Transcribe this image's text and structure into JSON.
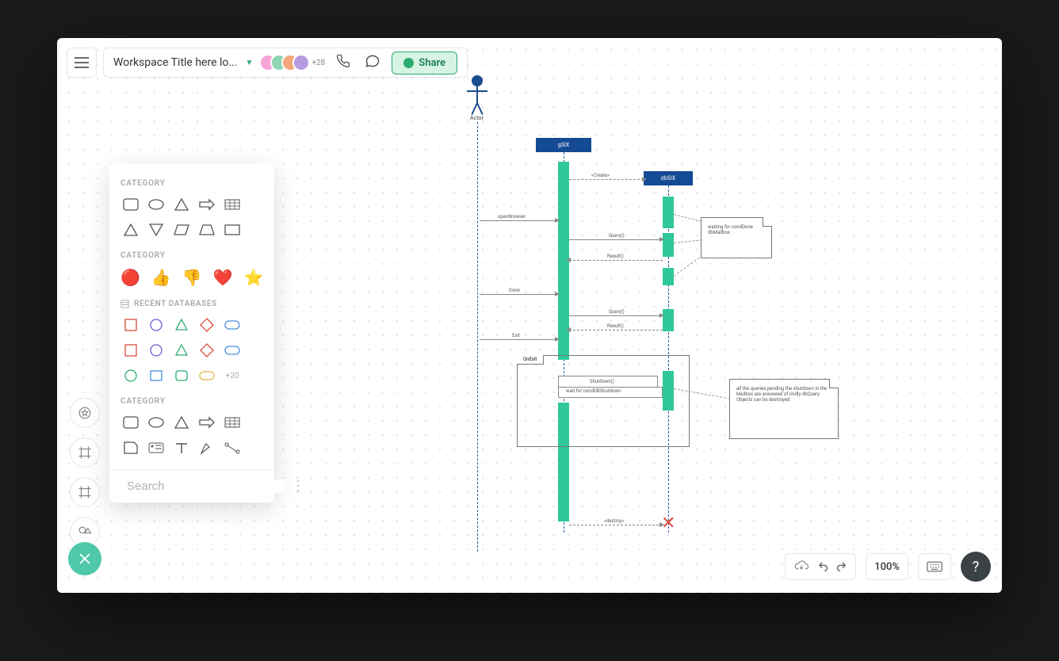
{
  "topbar": {
    "workspace_title": "Workspace Title here lo...",
    "avatar_overflow": "+28",
    "share_label": "Share"
  },
  "panel": {
    "cat1": "CATEGORY",
    "cat2": "CATEGORY",
    "db_label": "RECENT DATABASES",
    "more": "+20",
    "cat3": "CATEGORY",
    "search_placeholder": "Search"
  },
  "diagram": {
    "actor_label": "Actor",
    "head_gsix": "gSIX",
    "head_dbsix": "dbSIX",
    "msg_openbrowser": "openBrowser",
    "msg_create": "«Create»",
    "msg_query1": "Query()",
    "msg_result1": "Result()",
    "msg_done": "Done",
    "msg_query2": "Query()",
    "msg_result2": "Result()",
    "msg_exit": "Exit",
    "frag_label": "OnExit",
    "msg_shutdown": "Shutdown()",
    "msg_wait": "wait for condDBShutdown",
    "msg_destroy": "«destroy»",
    "note1": "waiting for condDone dbMailbox",
    "note2": "all the queries pending the shutdown in the Mailbox are answered of imdly dbQuery Objects can be destroyed"
  },
  "bottom": {
    "zoom": "100%"
  }
}
